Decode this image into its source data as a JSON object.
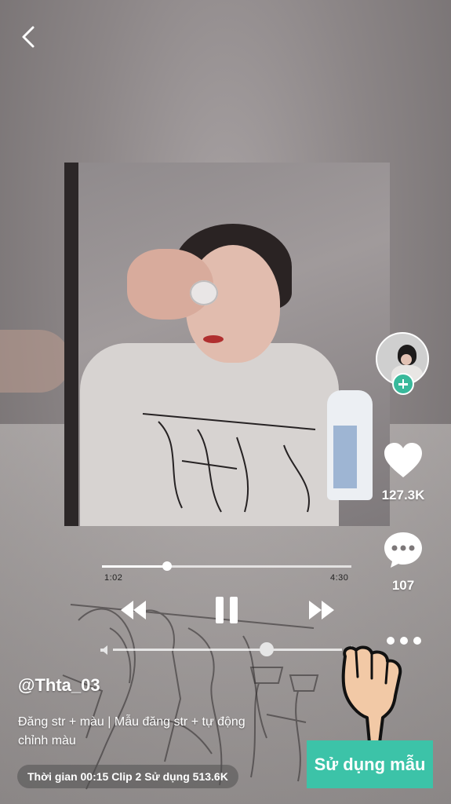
{
  "header": {
    "back_icon": "chevron-left-icon"
  },
  "player": {
    "current_time": "1:02",
    "total_time": "4:30",
    "progress": 0.26,
    "volume": 0.67,
    "rewind_icon": "rewind-icon",
    "pause_icon": "pause-icon",
    "forward_icon": "fast-forward-icon"
  },
  "sidebar": {
    "avatar": "creator-avatar",
    "follow_icon": "plus-icon",
    "like_count": "127.3K",
    "comment_count": "107",
    "more_icon": "more-dots-icon"
  },
  "post": {
    "username": "@Thta_03",
    "description": "Đăng str + màu | Mẫu đăng str + tự động chỉnh màu",
    "meta": "Thời gian 00:15 Clip 2 Sử dụng 513.6K"
  },
  "cta": {
    "label": "Sử dụng mẫu",
    "color": "#3cc3a8"
  }
}
